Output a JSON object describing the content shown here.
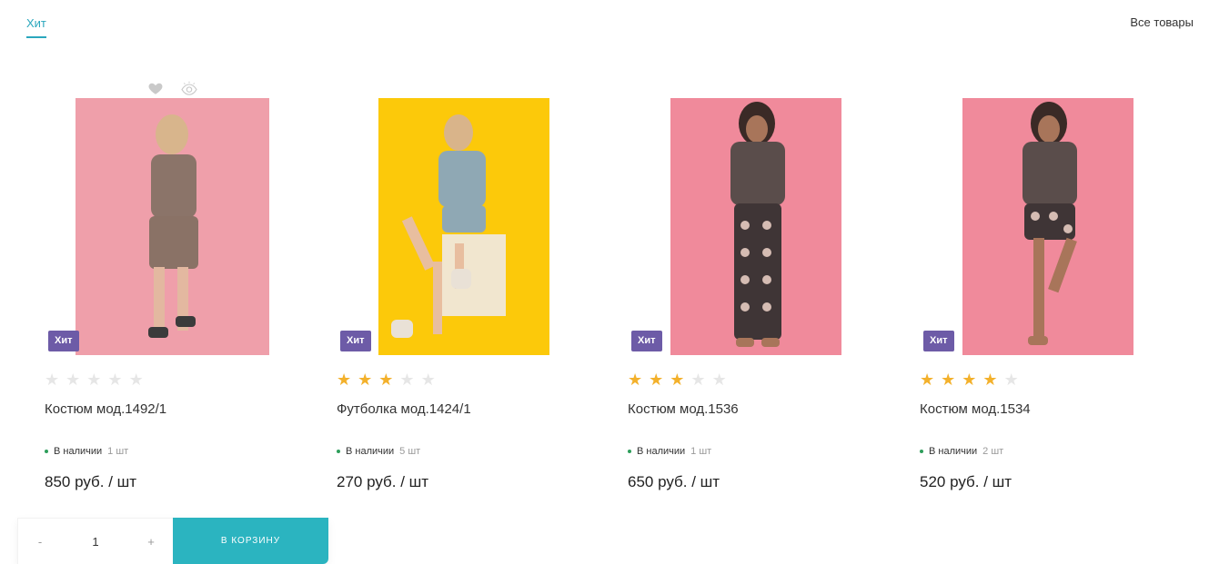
{
  "tabs": {
    "active": "Хит"
  },
  "all_link": "Все товары",
  "colors": {
    "accent": "#2aa7bd",
    "badge": "#6d5ba7",
    "button": "#2bb4c0",
    "star_on": "#f3b12c",
    "stock_dot": "#2e9e5b"
  },
  "products": [
    {
      "badge": "Хит",
      "rating": 0,
      "title": "Костюм мод.1492/1",
      "stock_label": "В наличии",
      "stock_count": "1 шт",
      "price": "850 руб. / шт"
    },
    {
      "badge": "Хит",
      "rating": 3,
      "title": "Футболка мод.1424/1",
      "stock_label": "В наличии",
      "stock_count": "5 шт",
      "price": "270 руб. / шт"
    },
    {
      "badge": "Хит",
      "rating": 3,
      "title": "Костюм мод.1536",
      "stock_label": "В наличии",
      "stock_count": "1 шт",
      "price": "650 руб. / шт"
    },
    {
      "badge": "Хит",
      "rating": 4,
      "title": "Костюм мод.1534",
      "stock_label": "В наличии",
      "stock_count": "2 шт",
      "price": "520 руб. / шт"
    }
  ],
  "icons": {
    "favorite": "heart-icon",
    "quick_view": "eye-icon",
    "star": "star-icon"
  },
  "cart": {
    "minus": "-",
    "qty": "1",
    "plus": "+",
    "button": "В КОРЗИНУ"
  }
}
